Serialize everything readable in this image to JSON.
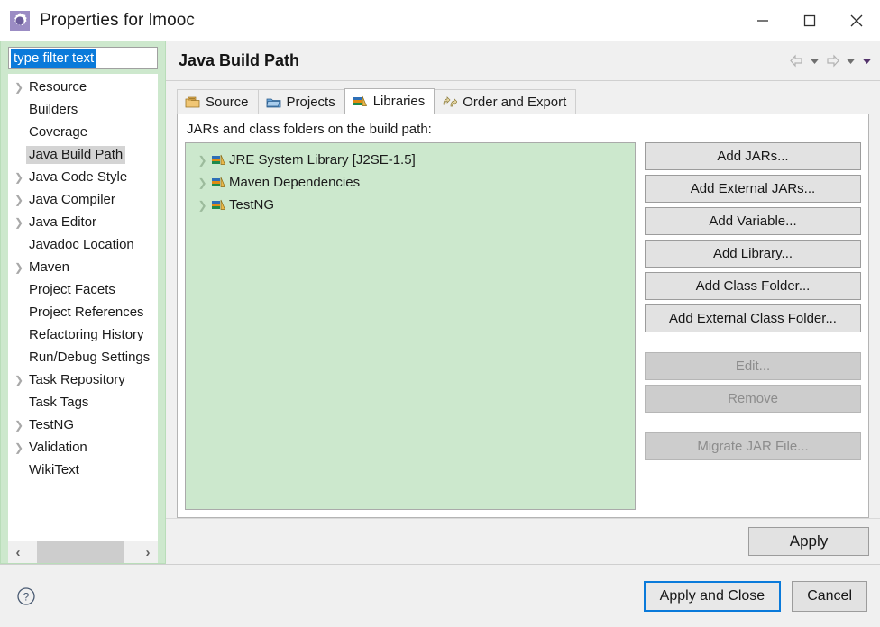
{
  "window": {
    "title": "Properties for lmooc",
    "icon": "properties-gear-icon",
    "minimize_label": "—",
    "maximize_label": "□",
    "close_label": "✕"
  },
  "sidebar": {
    "filter": {
      "value": "type filter text",
      "placeholder": "type filter text",
      "selected": true
    },
    "items": [
      {
        "label": "Resource",
        "expandable": true,
        "selected": false
      },
      {
        "label": "Builders",
        "expandable": false,
        "selected": false
      },
      {
        "label": "Coverage",
        "expandable": false,
        "selected": false
      },
      {
        "label": "Java Build Path",
        "expandable": false,
        "selected": true
      },
      {
        "label": "Java Code Style",
        "expandable": true,
        "selected": false
      },
      {
        "label": "Java Compiler",
        "expandable": true,
        "selected": false
      },
      {
        "label": "Java Editor",
        "expandable": true,
        "selected": false
      },
      {
        "label": "Javadoc Location",
        "expandable": false,
        "selected": false
      },
      {
        "label": "Maven",
        "expandable": true,
        "selected": false
      },
      {
        "label": "Project Facets",
        "expandable": false,
        "selected": false
      },
      {
        "label": "Project References",
        "expandable": false,
        "selected": false
      },
      {
        "label": "Refactoring History",
        "expandable": false,
        "selected": false
      },
      {
        "label": "Run/Debug Settings",
        "expandable": false,
        "selected": false
      },
      {
        "label": "Task Repository",
        "expandable": true,
        "selected": false
      },
      {
        "label": "Task Tags",
        "expandable": false,
        "selected": false
      },
      {
        "label": "TestNG",
        "expandable": true,
        "selected": false
      },
      {
        "label": "Validation",
        "expandable": true,
        "selected": false
      },
      {
        "label": "WikiText",
        "expandable": false,
        "selected": false
      }
    ],
    "scrollbar": {
      "left_arrow": "‹",
      "right_arrow": "›"
    }
  },
  "page": {
    "title": "Java Build Path",
    "nav": {
      "back_icon": "arrow-left-icon",
      "back_menu_icon": "chevron-down-icon",
      "forward_icon": "arrow-right-icon",
      "forward_menu_icon": "chevron-down-icon",
      "view_menu_icon": "chevron-down-icon"
    },
    "tabs": [
      {
        "label": "Source",
        "icon": "source-folder-icon",
        "active": false
      },
      {
        "label": "Projects",
        "icon": "project-folder-icon",
        "active": false
      },
      {
        "label": "Libraries",
        "icon": "libraries-books-icon",
        "active": true
      },
      {
        "label": "Order and Export",
        "icon": "order-export-icon",
        "active": false
      }
    ],
    "list_label": "JARs and class folders on the build path:",
    "libraries": [
      {
        "label": "JRE System Library [J2SE-1.5]",
        "icon": "library-icon",
        "expandable": true
      },
      {
        "label": "Maven Dependencies",
        "icon": "library-icon",
        "expandable": true
      },
      {
        "label": "TestNG",
        "icon": "library-icon",
        "expandable": true
      }
    ],
    "buttons": [
      {
        "label": "Add JARs...",
        "enabled": true
      },
      {
        "label": "Add External JARs...",
        "enabled": true
      },
      {
        "label": "Add Variable...",
        "enabled": true
      },
      {
        "label": "Add Library...",
        "enabled": true
      },
      {
        "label": "Add Class Folder...",
        "enabled": true
      },
      {
        "label": "Add External Class Folder...",
        "enabled": true
      },
      {
        "label": "Edit...",
        "enabled": false
      },
      {
        "label": "Remove",
        "enabled": false
      },
      {
        "label": "Migrate JAR File...",
        "enabled": false
      }
    ],
    "apply_label": "Apply"
  },
  "footer": {
    "help_icon": "help-question-icon",
    "apply_and_close_label": "Apply and Close",
    "cancel_label": "Cancel"
  },
  "colors": {
    "selection_blue": "#0a7ada",
    "panel_green": "#cde8cd",
    "list_green": "#cce8cd",
    "tree_selected_gray": "#d4d4d4",
    "button_face": "#e2e2e2",
    "disabled_face": "#cdcdcd"
  }
}
